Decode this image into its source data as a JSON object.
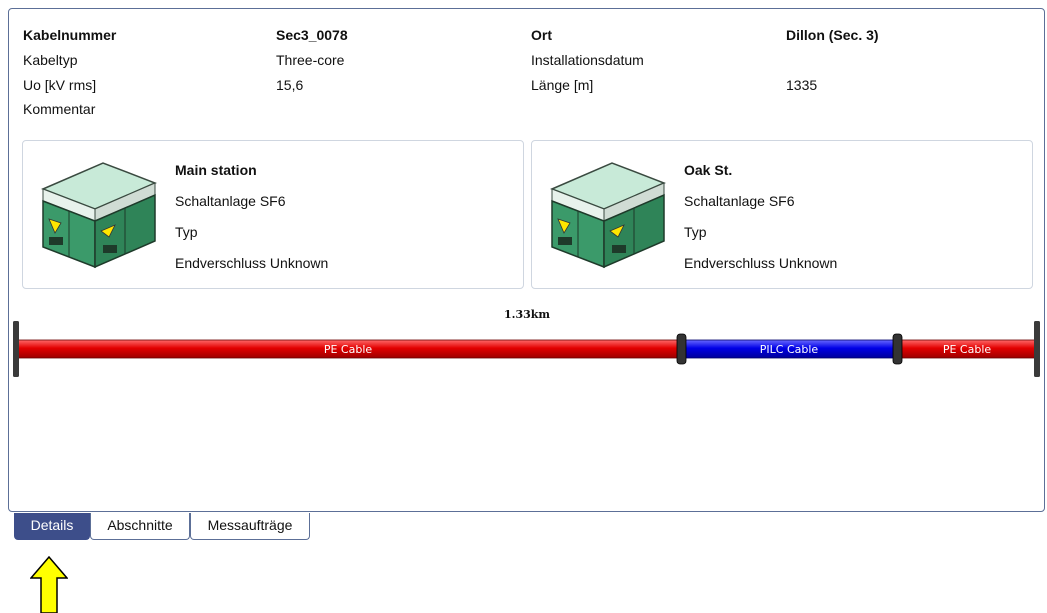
{
  "cable": {
    "kabelnummer_label": "Kabelnummer",
    "kabelnummer_value": "Sec3_0078",
    "ort_label": "Ort",
    "ort_value": "Dillon (Sec. 3)",
    "kabeltyp_label": "Kabeltyp",
    "kabeltyp_value": "Three-core",
    "installationsdatum_label": "Installationsdatum",
    "installationsdatum_value": "",
    "uo_label": "Uo [kV rms]",
    "uo_value": "15,6",
    "laenge_label": "Länge [m]",
    "laenge_value": "1335",
    "kommentar_label": "Kommentar",
    "kommentar_value": ""
  },
  "stations": [
    {
      "name": "Main station",
      "schaltanlage": "Schaltanlage  SF6",
      "typ": "Typ",
      "endverschluss": "Endverschluss Unknown"
    },
    {
      "name": "Oak St.",
      "schaltanlage": "Schaltanlage  SF6",
      "typ": "Typ",
      "endverschluss": "Endverschluss Unknown"
    }
  ],
  "cable_diagram": {
    "total_length_label": "1.33km",
    "sections": [
      {
        "label": "PE Cable",
        "color": "#e00000"
      },
      {
        "label": "PILC Cable",
        "color": "#0000e0"
      },
      {
        "label": "PE Cable",
        "color": "#e00000"
      }
    ]
  },
  "tabs": [
    {
      "label": "Details",
      "active": true
    },
    {
      "label": "Abschnitte",
      "active": false
    },
    {
      "label": "Messaufträge",
      "active": false
    }
  ],
  "colors": {
    "accent": "#3d4e8a",
    "border": "#5c6f97",
    "arrow_fill": "#ffff00"
  }
}
